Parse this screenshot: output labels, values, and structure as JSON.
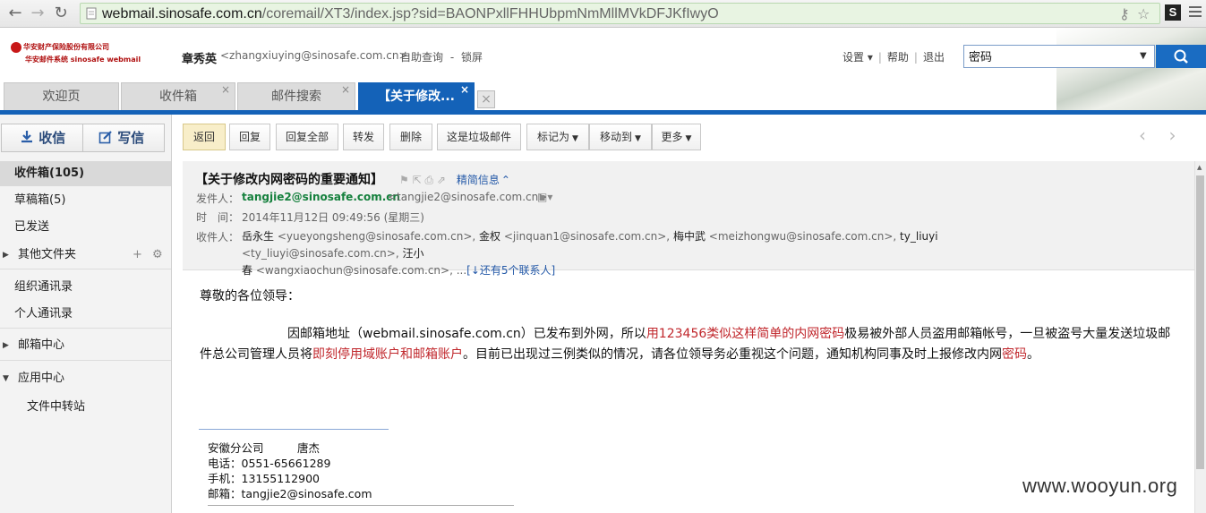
{
  "browser": {
    "url_host": "webmail.sinosafe.com.cn",
    "url_path": "/coremail/XT3/index.jsp?sid=BAONPxllFHHUbpmNmMllMVkDFJKfIwyO",
    "extension_label": "S"
  },
  "header": {
    "logo_line1": "华安财产保险股份有限公司",
    "logo_line2": "华安邮件系统   sinosafe webmail",
    "user_name": "章秀英",
    "user_email": "<zhangxiuying@sinosafe.com.cn>",
    "link_query": "自助查询",
    "link_sep": "-",
    "link_lock": "锁屏",
    "settings": "设置 ▾",
    "help": "帮助",
    "logout": "退出",
    "search_value": "密码"
  },
  "tabs": [
    {
      "label": "欢迎页"
    },
    {
      "label": "收件箱"
    },
    {
      "label": "邮件搜索"
    },
    {
      "label": "【关于修改..."
    }
  ],
  "sidebar": {
    "receive": "收信",
    "write": "写信",
    "items": [
      {
        "label": "收件箱(105)"
      },
      {
        "label": "草稿箱(5)"
      },
      {
        "label": "已发送"
      },
      {
        "label": "其他文件夹"
      },
      {
        "label": "组织通讯录"
      },
      {
        "label": "个人通讯录"
      },
      {
        "label": "邮箱中心"
      },
      {
        "label": "应用中心"
      },
      {
        "label": "文件中转站"
      }
    ]
  },
  "toolbar": {
    "back": "返回",
    "reply": "回复",
    "reply_all": "回复全部",
    "forward": "转发",
    "delete": "删除",
    "spam": "这是垃圾邮件",
    "mark_as": "标记为",
    "move_to": "移动到",
    "more": "更多"
  },
  "mail": {
    "subject": "【关于修改内网密码的重要通知】",
    "brief_info": "精简信息",
    "from_label": "发件人：",
    "from_name": "tangjie2@sinosafe.com.cn",
    "from_addr": "<tangjie2@sinosafe.com.cn>",
    "time_label": "时　间：",
    "time_value": "2014年11月12日 09:49:56 (星期三)",
    "to_label": "收件人：",
    "recipients_line1": [
      {
        "name": "岳永生",
        "addr": "<yueyongsheng@sinosafe.com.cn>,"
      },
      {
        "name": "金权",
        "addr": "<jinquan1@sinosafe.com.cn>,"
      },
      {
        "name": "梅中武",
        "addr": "<meizhongwu@sinosafe.com.cn>,"
      },
      {
        "name": "ty_liuyi",
        "addr": "<ty_liuyi@sinosafe.com.cn>,"
      },
      {
        "name": "汪小",
        "addr": ""
      }
    ],
    "recipients_line2_name": "春",
    "recipients_line2_addr": "<wangxiaochun@sinosafe.com.cn>, ...",
    "more_contacts": "[↓还有5个联系人]",
    "greeting": "尊敬的各位领导：",
    "para_1": "因邮箱地址（webmail.sinosafe.com.cn）已发布到外网，所以",
    "para_red1": "用123456类似这样简单的内网密码",
    "para_2": "极易被外部人员盗用邮箱帐号，一旦被盗号大量发送垃圾邮件总公司管理人员将",
    "para_red2": "即刻停用域账户和邮箱账户",
    "para_3": "。目前已出现过三例类似的情况，请各位领导务必重视这个问题，通知机构同事及时上报修改内网",
    "para_red3": "密码",
    "para_4": "。",
    "sig_company": "安徽分公司　　　唐杰",
    "sig_phone": "电话：0551-65661289",
    "sig_mobile": "手机：13155112900",
    "sig_email": "邮箱：tangjie2@sinosafe.com"
  },
  "watermark": "www.wooyun.org",
  "colors": {
    "accent": "#1462b8",
    "green_name": "#15803d",
    "red_text": "#c0262b"
  }
}
